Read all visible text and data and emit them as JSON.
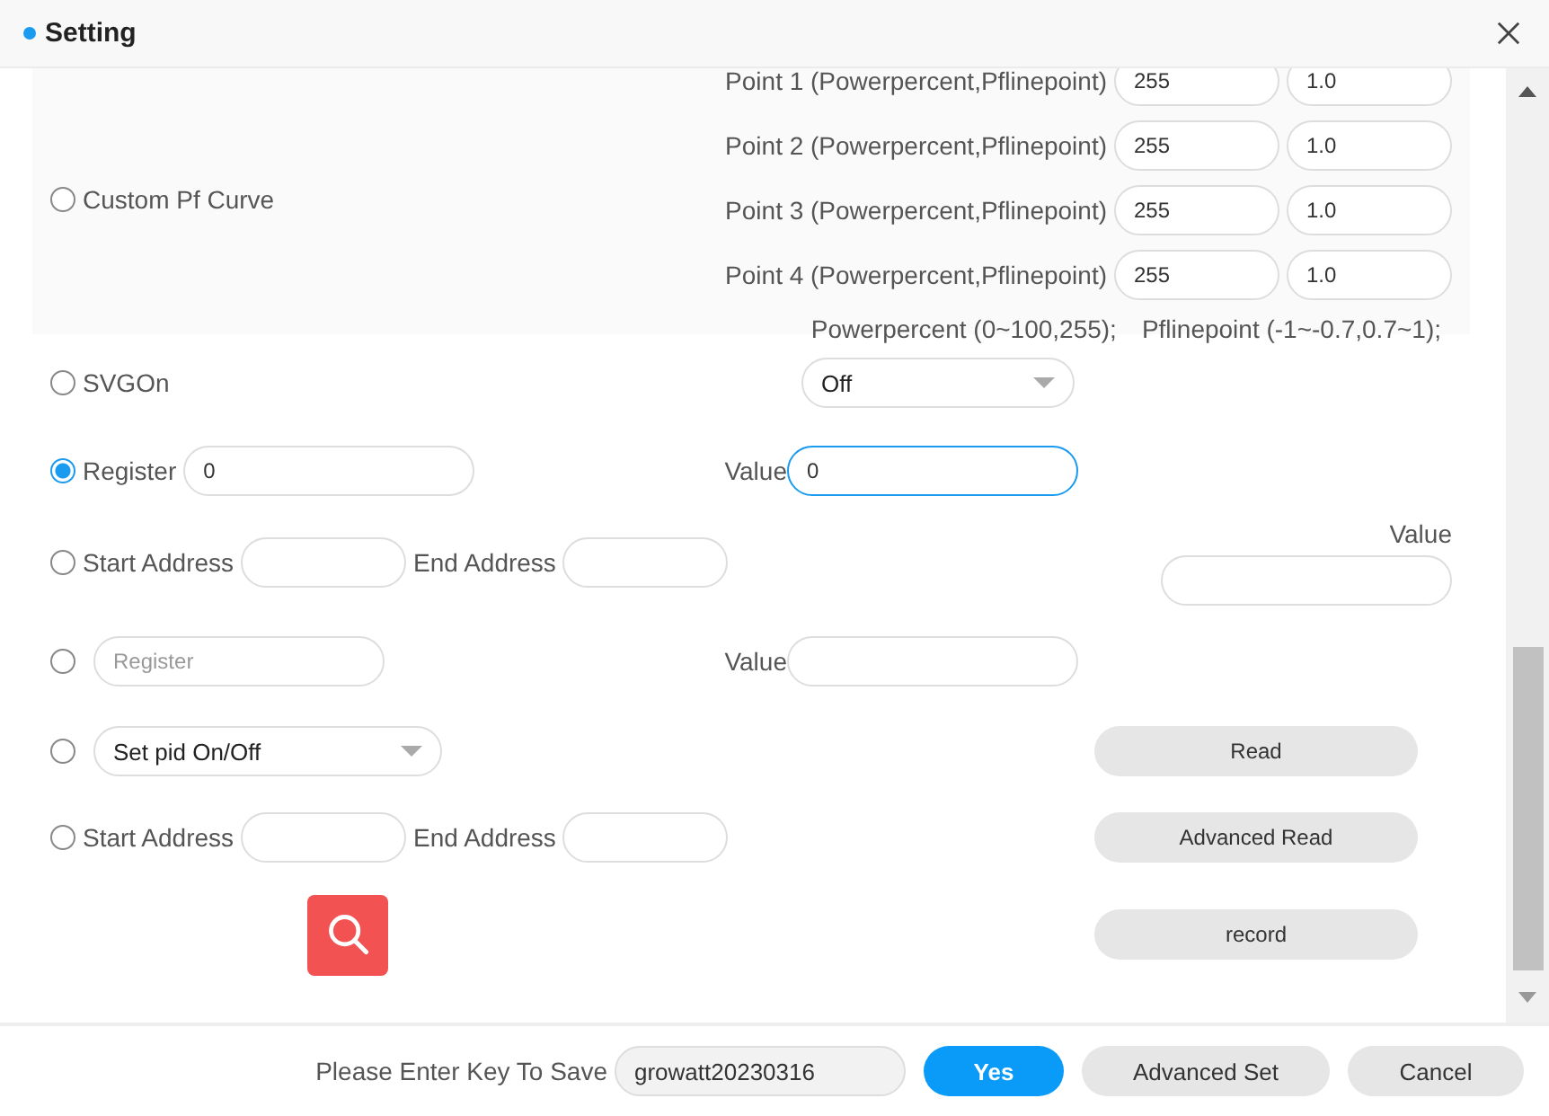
{
  "window": {
    "title": "Setting"
  },
  "options": [
    {
      "kind": "curve",
      "label": "Custom Pf Curve",
      "selected": false,
      "points": [
        {
          "label": "Point 1 (Powerpercent,Pflinepoint)",
          "power": "255",
          "pf": "1.0"
        },
        {
          "label": "Point 2 (Powerpercent,Pflinepoint)",
          "power": "255",
          "pf": "1.0"
        },
        {
          "label": "Point 3 (Powerpercent,Pflinepoint)",
          "power": "255",
          "pf": "1.0"
        },
        {
          "label": "Point 4 (Powerpercent,Pflinepoint)",
          "power": "255",
          "pf": "1.0"
        }
      ],
      "hints": [
        "Powerpercent (0~100,255);",
        "Pflinepoint (-1~-0.7,0.7~1);"
      ]
    },
    {
      "kind": "select",
      "label": "SVGOn",
      "selected": false,
      "select_value": "Off"
    },
    {
      "kind": "register",
      "label": "Register",
      "selected": true,
      "register_value": "0",
      "value_label": "Value",
      "value": "0",
      "focused": true
    },
    {
      "kind": "range",
      "label": "Start Address",
      "selected": false,
      "end_label": "End Address",
      "side_label": "Value"
    },
    {
      "kind": "register",
      "selected": false,
      "register_placeholder": "Register",
      "value_label": "Value",
      "focused": false
    },
    {
      "kind": "pid",
      "selected": false,
      "select_value": "Set pid On/Off",
      "button": "Read"
    },
    {
      "kind": "range",
      "label": "Start Address",
      "selected": false,
      "end_label": "End Address",
      "button": "Advanced Read"
    },
    {
      "kind": "search",
      "button": "record"
    }
  ],
  "footer": {
    "key_label": "Please Enter Key To Save",
    "key_value": "growatt20230316",
    "buttons": [
      {
        "label": "Yes",
        "kind": "primary"
      },
      {
        "label": "Advanced Set",
        "kind": "plain"
      },
      {
        "label": "Cancel",
        "kind": "plain"
      }
    ]
  }
}
